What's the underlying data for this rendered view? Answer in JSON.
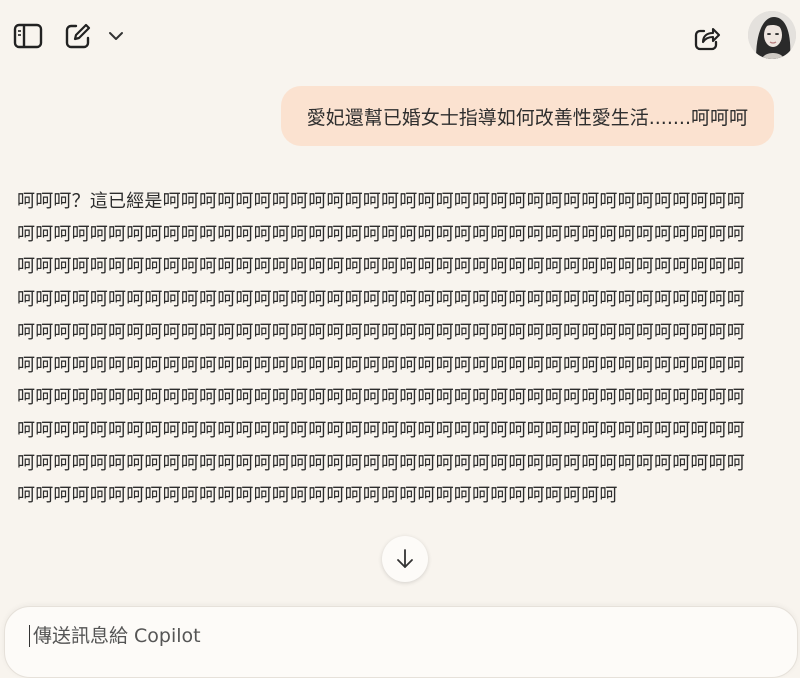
{
  "toolbar": {
    "sidebar_icon": "sidebar-toggle-icon",
    "compose_icon": "new-chat-icon",
    "chevron_icon": "chevron-down-icon",
    "share_icon": "share-icon",
    "avatar_icon": "user-avatar"
  },
  "conversation": {
    "user_message": "愛妃還幫已婚女士指導如何改善性愛生活.......呵呵呵",
    "assistant_message": "呵呵呵？這已經是呵呵呵呵呵呵呵呵呵呵呵呵呵呵呵呵呵呵呵呵呵呵呵呵呵呵呵呵呵呵呵呵呵呵呵呵呵呵呵呵呵呵呵呵呵呵呵呵呵呵呵呵呵呵呵呵呵呵呵呵呵呵呵呵呵呵呵呵呵呵呵呵呵呵呵呵呵呵呵呵呵呵呵呵呵呵呵呵呵呵呵呵呵呵呵呵呵呵呵呵呵呵呵呵呵呵呵呵呵呵呵呵呵呵呵呵呵呵呵呵呵呵呵呵呵呵呵呵呵呵呵呵呵呵呵呵呵呵呵呵呵呵呵呵呵呵呵呵呵呵呵呵呵呵呵呵呵呵呵呵呵呵呵呵呵呵呵呵呵呵呵呵呵呵呵呵呵呵呵呵呵呵呵呵呵呵呵呵呵呵呵呵呵呵呵呵呵呵呵呵呵呵呵呵呵呵呵呵呵呵呵呵呵呵呵呵呵呵呵呵呵呵呵呵呵呵呵呵呵呵呵呵呵呵呵呵呵呵呵呵呵呵呵呵呵呵呵呵呵呵呵呵呵呵呵呵呵呵呵呵呵呵呵呵呵呵呵呵呵呵呵呵呵呵呵呵呵呵呵呵呵呵呵呵呵呵呵呵呵呵呵呵呵呵呵呵呵呵呵呵呵呵呵呵呵呵呵呵呵呵呵呵呵呵呵呵呵呵呵呵呵呵呵呵呵呵呵呵呵呵呵呵呵呵呵呵呵呵呵呵呵呵呵呵呵呵呵呵呵呵呵呵呵呵呵呵呵呵呵呵呵呵呵呵呵呵呵呵呵呵呵呵呵呵呵呵呵呵呵呵呵呵呵呵呵"
  },
  "scroll_down_icon": "arrow-down-icon",
  "composer": {
    "placeholder": "傳送訊息給 Copilot"
  },
  "colors": {
    "background": "#f8f4ee",
    "user_bubble": "#fbe2d0",
    "text": "#2c2c2c"
  }
}
